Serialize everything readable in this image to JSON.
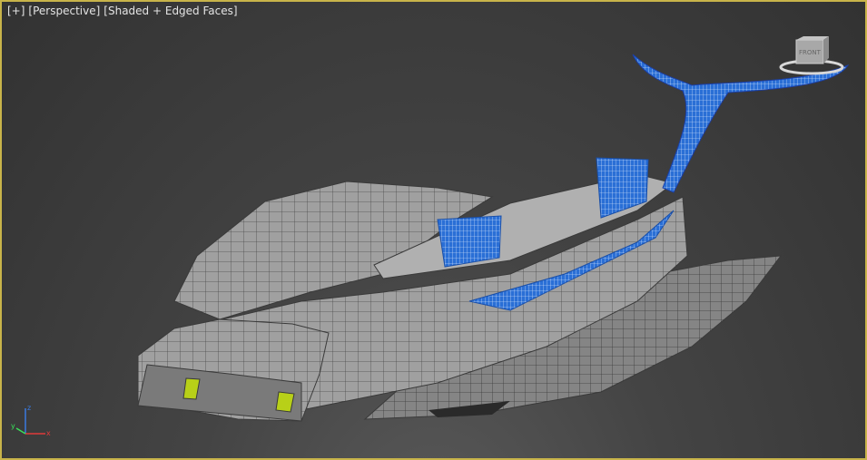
{
  "viewport": {
    "labels": [
      {
        "text": "[+]"
      },
      {
        "text": "[Perspective]"
      },
      {
        "text": "[Shaded + Edged Faces]"
      }
    ],
    "active_border_color": "#c8b44a",
    "background_color": "#3c3c3c"
  },
  "model": {
    "mesh_color": "#9c9c9c",
    "edge_color": "#3a3a3a",
    "selected_color": "#2a6fd6",
    "highlight_color": "#b8d018"
  },
  "viewcube": {
    "face_label": "FRONT",
    "icon": "viewcube-icon"
  },
  "axis_tripod": {
    "x_label": "x",
    "y_label": "y",
    "z_label": "z"
  }
}
